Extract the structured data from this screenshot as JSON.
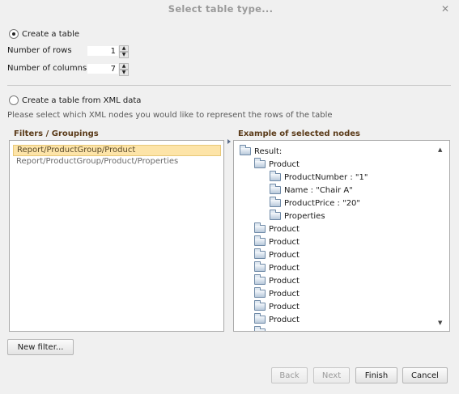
{
  "dialog": {
    "title": "Select table type...",
    "close_icon": "close-icon"
  },
  "create_table": {
    "radio_label": "Create a table",
    "selected": true,
    "rows_label": "Number of rows",
    "rows_value": "1",
    "columns_label": "Number of columns",
    "columns_value": "7"
  },
  "from_xml": {
    "radio_label": "Create a table from XML data",
    "selected": false,
    "help_text": "Please select which XML nodes you would like to represent the rows of the table"
  },
  "filters_panel": {
    "title": "Filters / Groupings",
    "items": [
      {
        "label": "Report/ProductGroup/Product",
        "selected": true
      },
      {
        "label": "Report/ProductGroup/Product/Properties",
        "selected": false
      }
    ],
    "new_filter_label": "New filter..."
  },
  "example_panel": {
    "title": "Example of selected nodes",
    "nodes": [
      {
        "label": "Result:",
        "depth": 0
      },
      {
        "label": "Product",
        "depth": 1
      },
      {
        "label": "ProductNumber  : \"1\"",
        "depth": 2
      },
      {
        "label": "Name  : \"Chair A\"",
        "depth": 2
      },
      {
        "label": "ProductPrice  : \"20\"",
        "depth": 2
      },
      {
        "label": "Properties",
        "depth": 2
      },
      {
        "label": "Product",
        "depth": 1
      },
      {
        "label": "Product",
        "depth": 1
      },
      {
        "label": "Product",
        "depth": 1
      },
      {
        "label": "Product",
        "depth": 1
      },
      {
        "label": "Product",
        "depth": 1
      },
      {
        "label": "Product",
        "depth": 1
      },
      {
        "label": "Product",
        "depth": 1
      },
      {
        "label": "Product",
        "depth": 1
      }
    ]
  },
  "footer": {
    "back_label": "Back",
    "next_label": "Next",
    "finish_label": "Finish",
    "cancel_label": "Cancel"
  },
  "colors": {
    "selected_item_bg": "#fde4a8",
    "panel_title": "#5a3a18"
  }
}
